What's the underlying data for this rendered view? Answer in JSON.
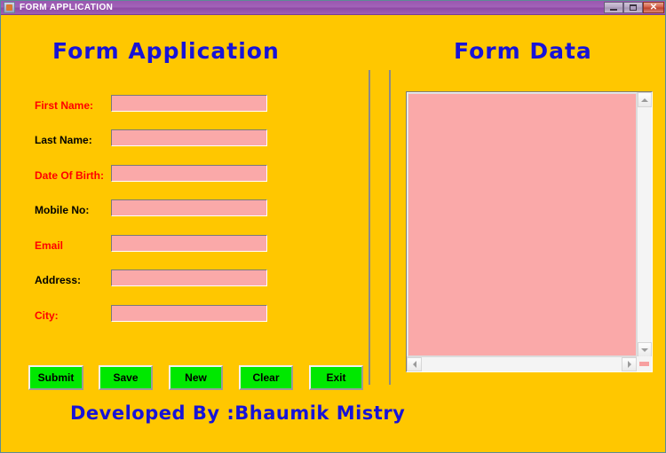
{
  "window": {
    "title": "FORM APPLICATION",
    "icon": "app-icon",
    "controls": {
      "minimize": "minimize-icon",
      "maximize": "maximize-icon",
      "close": "✕"
    },
    "background_color": "#FFC700",
    "titlebar_color": "#9a56b0"
  },
  "left_panel": {
    "heading": "Form Application",
    "heading_color": "#1713D8",
    "fields": [
      {
        "label": "First Name:",
        "value": "",
        "placeholder": "",
        "label_color": "#FF0000"
      },
      {
        "label": "Last Name:",
        "value": "",
        "placeholder": "",
        "label_color": "#000000"
      },
      {
        "label": "Date Of Birth:",
        "value": "",
        "placeholder": "",
        "label_color": "#FF0000"
      },
      {
        "label": "Mobile No:",
        "value": "",
        "placeholder": "",
        "label_color": "#000000"
      },
      {
        "label": "Email",
        "value": "",
        "placeholder": "",
        "label_color": "#FF0000"
      },
      {
        "label": "Address:",
        "value": "",
        "placeholder": "",
        "label_color": "#000000"
      },
      {
        "label": "City:",
        "value": "",
        "placeholder": "",
        "label_color": "#FF0000"
      }
    ],
    "buttons": [
      {
        "label": "Submit",
        "color": "#00E800"
      },
      {
        "label": "Save",
        "color": "#00E800"
      },
      {
        "label": "New",
        "color": "#00E800"
      },
      {
        "label": "Clear",
        "color": "#00E800"
      },
      {
        "label": "Exit",
        "color": "#00E800"
      }
    ]
  },
  "right_panel": {
    "heading": "Form Data",
    "heading_color": "#1713D8",
    "textarea_value": "",
    "textarea_placeholder": "",
    "textarea_color": "#FAA9A9"
  },
  "footer": {
    "credit": "Developed By :Bhaumik Mistry",
    "color": "#1713D8"
  }
}
